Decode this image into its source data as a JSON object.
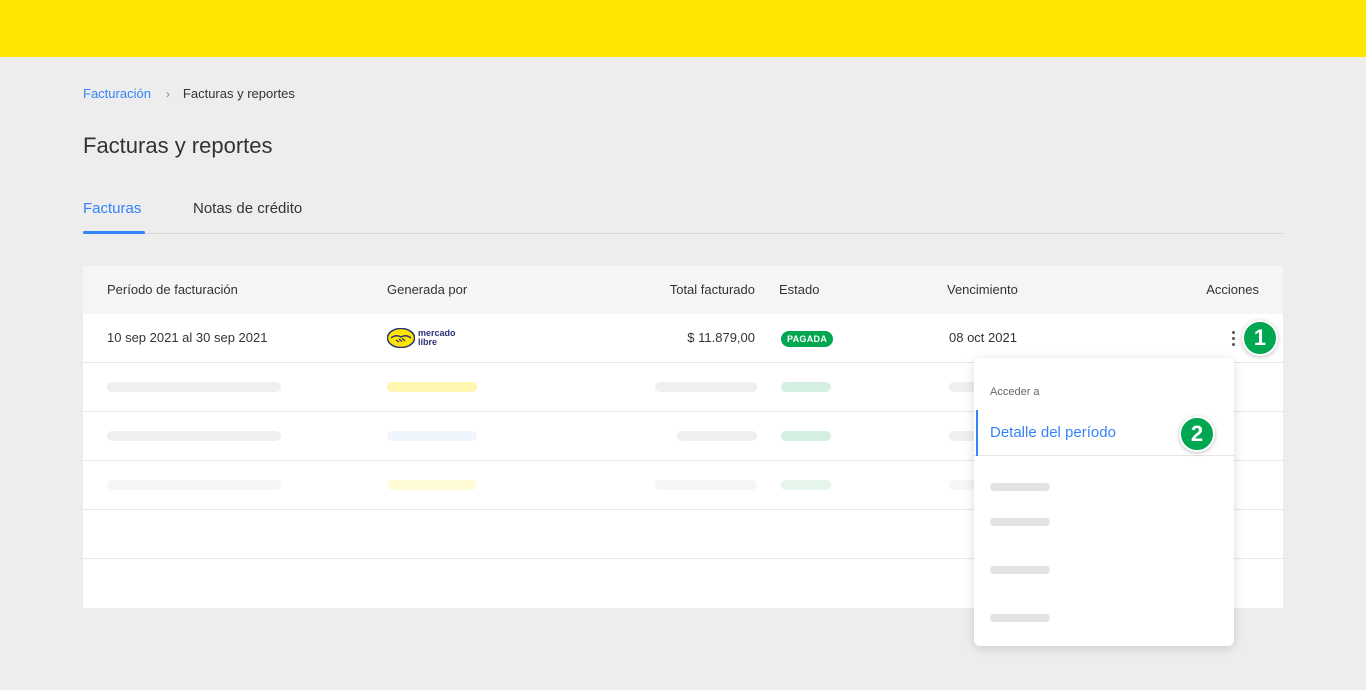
{
  "breadcrumb": {
    "parent": "Facturación",
    "current": "Facturas y reportes"
  },
  "page_title": "Facturas y reportes",
  "tabs": [
    {
      "label": "Facturas",
      "active": true
    },
    {
      "label": "Notas de crédito",
      "active": false
    }
  ],
  "table": {
    "columns": [
      "Período de facturación",
      "Generada por",
      "Total facturado",
      "Estado",
      "Vencimiento",
      "Acciones"
    ],
    "rows": [
      {
        "period": "10 sep 2021 al 30 sep 2021",
        "generated_by_logo_text_1": "mercado",
        "generated_by_logo_text_2": "libre",
        "total": "$ 11.879,00",
        "status": "PAGADA",
        "due": "08 oct 2021"
      }
    ]
  },
  "menu": {
    "header": "Acceder a",
    "active_item": "Detalle del período"
  },
  "markers": [
    "1",
    "2"
  ],
  "colors": {
    "brand_yellow": "#ffe600",
    "accent_blue": "#3483fa",
    "status_green": "#00a650"
  },
  "icons": {
    "breadcrumb_separator": "chevron-right-icon",
    "actions": "kebab-menu-icon",
    "logo": "mercado-libre-handshake-logo"
  }
}
